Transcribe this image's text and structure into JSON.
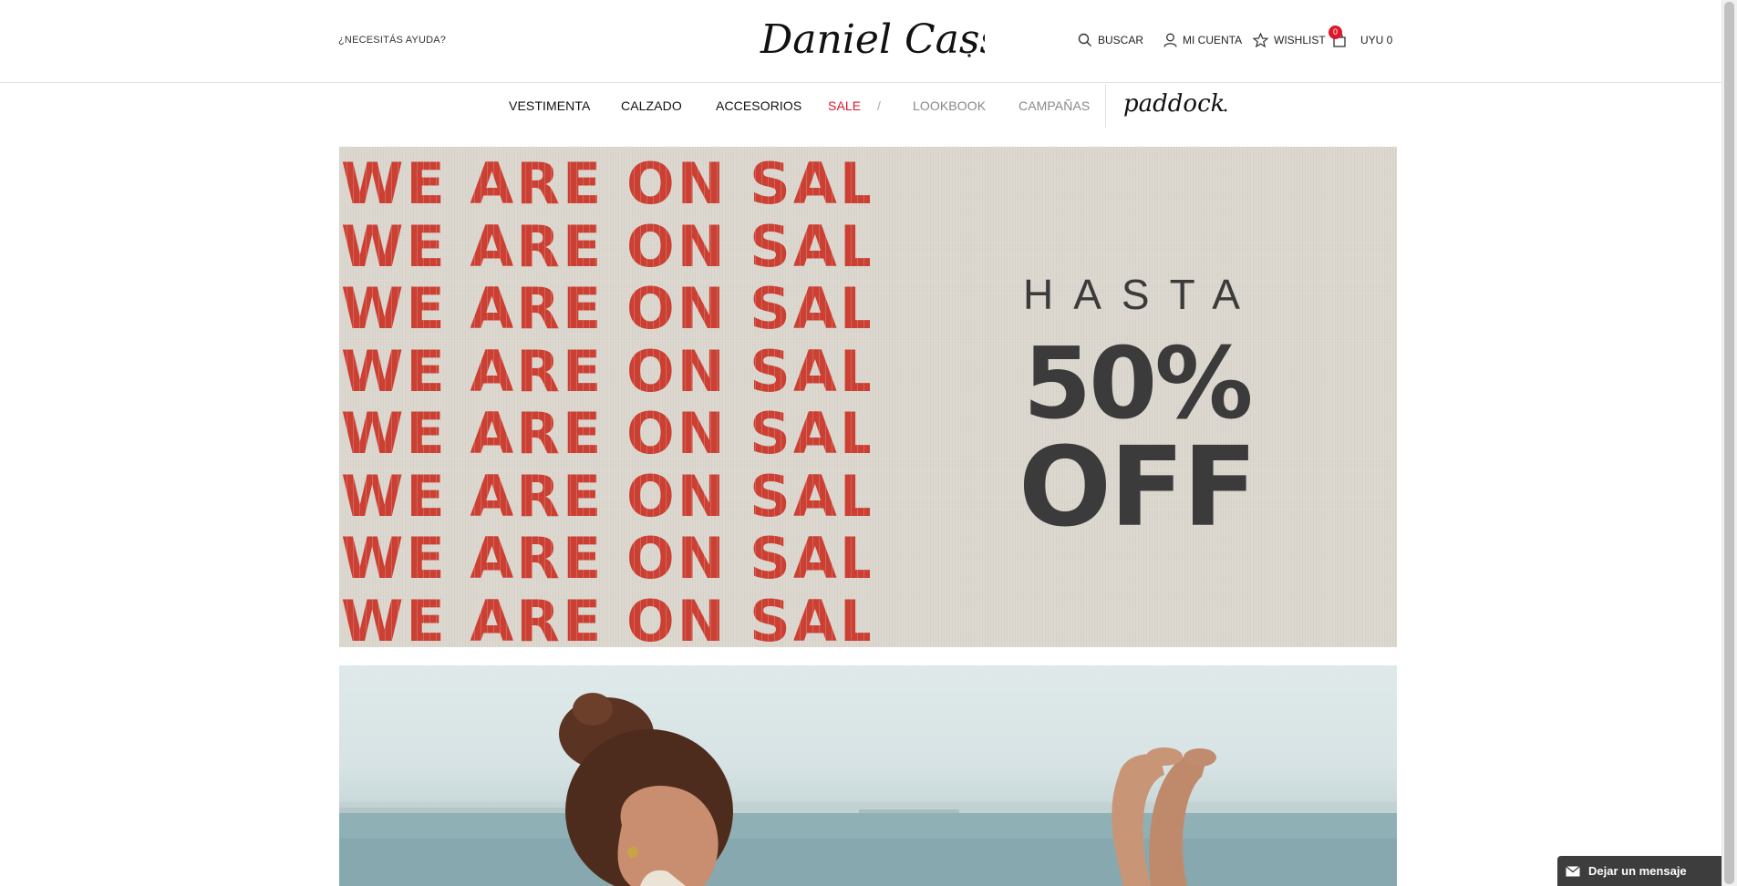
{
  "header": {
    "help_label": "¿NECESITÁS AYUDA?",
    "logo_text": "Daniel Cassin",
    "search_label": "BUSCAR",
    "account_label": "MI CUENTA",
    "wishlist_label": "WISHLIST",
    "cart_label": "UYU 0",
    "cart_count": "0",
    "icons": {
      "search": "search-icon",
      "account": "user-icon",
      "wishlist": "star-icon",
      "cart": "shopping-bag-icon"
    }
  },
  "nav": {
    "items": [
      {
        "label": "VESTIMENTA"
      },
      {
        "label": "CALZADO"
      },
      {
        "label": "ACCESORIOS"
      },
      {
        "label": "SALE"
      },
      {
        "label": "LOOKBOOK"
      },
      {
        "label": "CAMPAÑAS"
      }
    ],
    "separator": "/",
    "brand": "paddock"
  },
  "banner": {
    "repeat_text": "WE ARE ON SALE",
    "lines": [
      "WE ARE ON SALE",
      "WE ARE ON SALE",
      "WE ARE ON SALE",
      "WE ARE ON SALE",
      "WE ARE ON SALE",
      "WE ARE ON SALE",
      "WE ARE ON SALE",
      "WE ARE ON SALE"
    ],
    "hasta": "HASTA",
    "percent": "50%",
    "off": "OFF",
    "colors": {
      "background": "#dcd8cf",
      "accent": "#cc3f33",
      "dark": "#3b3b3b"
    }
  },
  "chat": {
    "label": "Dejar un mensaje",
    "icon": "envelope-icon"
  },
  "colors": {
    "sale_red": "#e0162b",
    "text": "#222222"
  }
}
